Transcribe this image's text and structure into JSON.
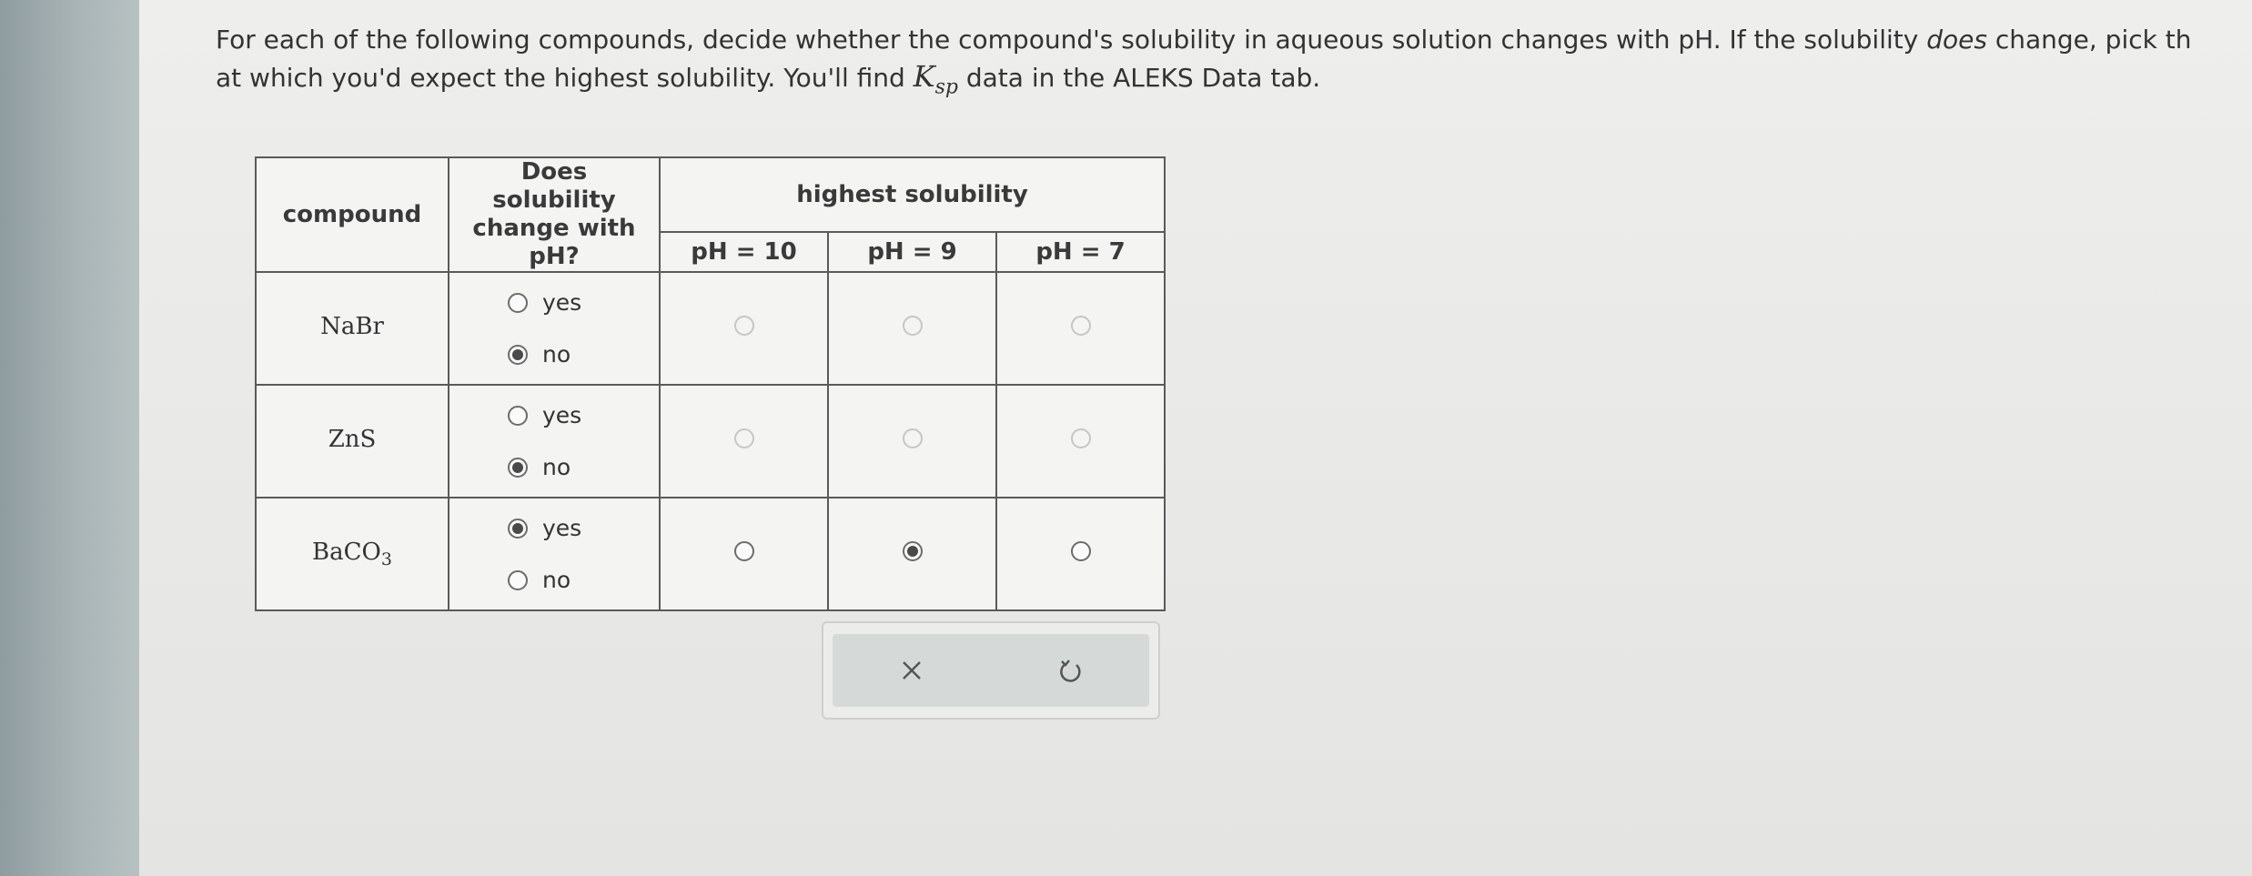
{
  "instructions": {
    "part1": "For each of the following compounds, decide whether the compound's solubility in aqueous solution changes with pH. If the solubility ",
    "does": "does",
    "part2": " change, pick th",
    "line2_a": "at which you'd expect the highest solubility. You'll find ",
    "ksp_k": "K",
    "ksp_sub": "sp",
    "line2_b": " data in the ALEKS Data tab."
  },
  "table": {
    "headers": {
      "compound": "compound",
      "change": "Does solubility change with pH?",
      "highest": "highest solubility",
      "ph_columns": [
        "pH = 10",
        "pH = 9",
        "pH = 7"
      ]
    },
    "option_labels": {
      "yes": "yes",
      "no": "no"
    },
    "rows": [
      {
        "compound_main": "NaBr",
        "compound_sub": "",
        "changes_with_ph": "no",
        "highest_solubility_ph": null
      },
      {
        "compound_main": "ZnS",
        "compound_sub": "",
        "changes_with_ph": "no",
        "highest_solubility_ph": null
      },
      {
        "compound_main": "BaCO",
        "compound_sub": "3",
        "changes_with_ph": "yes",
        "highest_solubility_ph": "pH = 9"
      }
    ]
  },
  "actions": {
    "clear_icon": "x-icon",
    "undo_icon": "undo-icon"
  },
  "colors": {
    "background": "#e9e9e7",
    "table_border": "#5a5a5a",
    "action_panel": "#d5dad9",
    "icon": "#555555"
  }
}
